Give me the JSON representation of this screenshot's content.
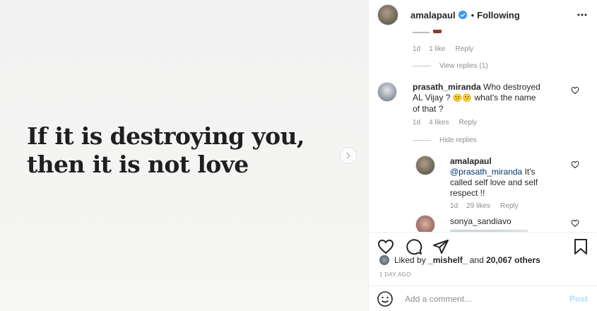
{
  "post": {
    "quote_line1": "If it is destroying you,",
    "quote_line2": "then it is not love"
  },
  "header": {
    "username": "amalapaul",
    "dot": "•",
    "following": "Following",
    "verified_color": "#3897f0"
  },
  "comments": {
    "partial_top": {
      "meta_time": "1d",
      "meta_likes": "1 like",
      "meta_reply": "Reply",
      "view_replies": "View replies (1)"
    },
    "c2": {
      "username": "prasath_miranda",
      "text_a": "Who destroyed",
      "text_b": "AL Vijay ?",
      "text_c": "what's the name",
      "text_d": "of that ?",
      "emoji": "😕😕",
      "meta_time": "1d",
      "meta_likes": "4 likes",
      "meta_reply": "Reply",
      "hide_replies": "Hide replies"
    },
    "reply": {
      "username": "amalapaul",
      "mention": "@prasath_miranda",
      "text_a": "It's",
      "text_b": "called self love and self",
      "text_c": "respect !!",
      "meta_time": "1d",
      "meta_likes": "29 likes",
      "meta_reply": "Reply"
    },
    "c4": {
      "username": "sonya_sandiavo"
    }
  },
  "likes": {
    "prefix": "Liked by",
    "user": "_mishelf_",
    "and": "and",
    "others": "20,067 others"
  },
  "timestamp": "1 DAY AGO",
  "add_comment": {
    "placeholder": "Add a comment...",
    "post_label": "Post"
  },
  "icons": {
    "like": "heart-icon",
    "comment": "comment-icon",
    "share": "paper-plane-icon",
    "save": "bookmark-icon",
    "emoji": "smiley-icon",
    "more": "more-options-icon",
    "next": "chevron-right-icon"
  }
}
